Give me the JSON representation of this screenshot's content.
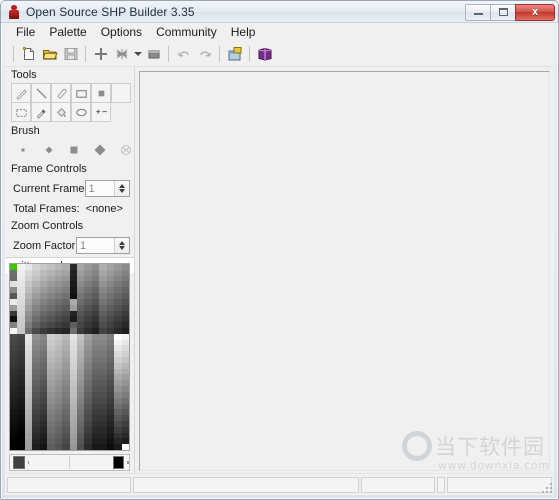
{
  "window": {
    "title": "Open Source SHP Builder 3.35",
    "app_icon": "shp-builder-icon",
    "minimize_label": "",
    "maximize_label": "",
    "close_label": "x"
  },
  "menubar": {
    "items": [
      {
        "label": "File"
      },
      {
        "label": "Palette"
      },
      {
        "label": "Options"
      },
      {
        "label": "Community"
      },
      {
        "label": "Help"
      }
    ]
  },
  "toolbar": {
    "buttons": [
      {
        "name": "new-file-icon",
        "enabled": true
      },
      {
        "name": "open-file-icon",
        "enabled": true
      },
      {
        "name": "save-file-icon",
        "enabled": false
      },
      {
        "name": "add-frame-icon",
        "enabled": true
      },
      {
        "name": "mesh-icon",
        "enabled": true
      },
      {
        "name": "fill-rect-icon",
        "enabled": true
      },
      {
        "name": "undo-icon",
        "enabled": false
      },
      {
        "name": "redo-icon",
        "enabled": false
      },
      {
        "name": "properties-icon",
        "enabled": true
      },
      {
        "name": "manual-book-icon",
        "enabled": true
      }
    ]
  },
  "tools_panel": {
    "title": "Tools",
    "tools": [
      {
        "name": "pencil-tool",
        "selected": false
      },
      {
        "name": "line-tool",
        "selected": false
      },
      {
        "name": "eraser-tool",
        "selected": false
      },
      {
        "name": "rectangle-tool",
        "selected": false
      },
      {
        "name": "filled-rect-tool",
        "selected": false
      },
      {
        "name": "empty-tool",
        "selected": false
      },
      {
        "name": "select-tool",
        "selected": false
      },
      {
        "name": "eyedropper-tool",
        "selected": false
      },
      {
        "name": "fill-bucket-tool",
        "selected": false
      },
      {
        "name": "ellipse-tool",
        "selected": false
      },
      {
        "name": "shift-colors-tool",
        "selected": false
      }
    ]
  },
  "brush_panel": {
    "title": "Brush",
    "sizes": [
      {
        "name": "brush-size-1"
      },
      {
        "name": "brush-size-2"
      },
      {
        "name": "brush-size-3"
      },
      {
        "name": "brush-size-4"
      },
      {
        "name": "brush-size-5"
      }
    ]
  },
  "frame_controls": {
    "title": "Frame Controls",
    "current_frame_label": "Current Frame",
    "current_frame_value": "1",
    "total_frames_label": "Total Frames:",
    "total_frames_value": "<none>"
  },
  "zoom_controls": {
    "title": "Zoom Controls",
    "zoom_factor_label": "Zoom Factor",
    "zoom_factor_value": "1"
  },
  "palette": {
    "name": "unittem.pal",
    "foreground_color": "#3f3f3f",
    "background_color": "#000000",
    "transparent_color": "#3cc800",
    "colors": [
      "#3cc800",
      "#f2f2f2",
      "#e8e8e8",
      "#d4d4d4",
      "#c8c8c8",
      "#c0c0c0",
      "#b6b6b6",
      "#aeaeae",
      "#2a2a2a",
      "#a8a8a8",
      "#9a9a9a",
      "#8e8e8e",
      "#b0b0b0",
      "#a4a4a4",
      "#989898",
      "#8c8c8c",
      "#6e6e6e",
      "#eeeeee",
      "#d8d8d8",
      "#cacaca",
      "#bcbcbc",
      "#b4b4b4",
      "#aaaaaa",
      "#a2a2a2",
      "#242424",
      "#9e9e9e",
      "#909090",
      "#848484",
      "#a6a6a6",
      "#9a9a9a",
      "#8e8e8e",
      "#828282",
      "#6a6a6a",
      "#eaeaea",
      "#d0d0d0",
      "#c0c0c0",
      "#b2b2b2",
      "#a8a8a8",
      "#9e9e9e",
      "#969696",
      "#1e1e1e",
      "#949494",
      "#868686",
      "#7a7a7a",
      "#9c9c9c",
      "#909090",
      "#848484",
      "#787878",
      "#e0e0e0",
      "#e6e6e6",
      "#c6c6c6",
      "#b4b4b4",
      "#a6a6a6",
      "#9c9c9c",
      "#929292",
      "#8a8a8a",
      "#1a1a1a",
      "#8a8a8a",
      "#7c7c7c",
      "#707070",
      "#929292",
      "#868686",
      "#7a7a7a",
      "#6e6e6e",
      "#8a8a8a",
      "#e2e2e2",
      "#bcbcbc",
      "#a8a8a8",
      "#9a9a9a",
      "#909090",
      "#868686",
      "#7e7e7e",
      "#161616",
      "#808080",
      "#727272",
      "#666666",
      "#888888",
      "#7c7c7c",
      "#707070",
      "#646464",
      "#565656",
      "#dedede",
      "#b2b2b2",
      "#9c9c9c",
      "#8e8e8e",
      "#848484",
      "#7a7a7a",
      "#727272",
      "#121212",
      "#767676",
      "#686868",
      "#5c5c5c",
      "#7e7e7e",
      "#727272",
      "#666666",
      "#5a5a5a",
      "#eaeaea",
      "#dadada",
      "#a8a8a8",
      "#909090",
      "#828282",
      "#787878",
      "#6e6e6e",
      "#666666",
      "#aaaaaa",
      "#6c6c6c",
      "#5e5e5e",
      "#525252",
      "#747474",
      "#686868",
      "#5c5c5c",
      "#505050",
      "#9c9c9c",
      "#d6d6d6",
      "#9e9e9e",
      "#848484",
      "#767676",
      "#6c6c6c",
      "#626262",
      "#5a5a5a",
      "#9e9e9e",
      "#626262",
      "#545454",
      "#484848",
      "#6a6a6a",
      "#5e5e5e",
      "#525252",
      "#464646",
      "#3a3a3a",
      "#d2d2d2",
      "#949494",
      "#787878",
      "#6a6a6a",
      "#606060",
      "#565656",
      "#4e4e4e",
      "#242424",
      "#585858",
      "#4a4a4a",
      "#3e3e3e",
      "#606060",
      "#545454",
      "#484848",
      "#3c3c3c",
      "#101010",
      "#cecece",
      "#8a8a8a",
      "#6c6c6c",
      "#5e5e5e",
      "#545454",
      "#4a4a4a",
      "#424242",
      "#1c1c1c",
      "#4e4e4e",
      "#404040",
      "#343434",
      "#565656",
      "#4a4a4a",
      "#3e3e3e",
      "#323232",
      "#828282",
      "#cacaca",
      "#7e7e7e",
      "#606060",
      "#525252",
      "#484848",
      "#3e3e3e",
      "#363636",
      "#5e5e5e",
      "#444444",
      "#363636",
      "#2a2a2a",
      "#4c4c4c",
      "#404040",
      "#343434",
      "#282828",
      "#f6f6f6",
      "#c6c6c6",
      "#6a6a6a",
      "#4a4a4a",
      "#3c3c3c",
      "#323232",
      "#2a2a2a",
      "#242424",
      "#707070",
      "#3a3a3a",
      "#2c2c2c",
      "#202020",
      "#424242",
      "#363636",
      "#2a2a2a",
      "#1e1e1e",
      "#4a4a4a",
      "#444444",
      "#e6e6e6",
      "#909090",
      "#868686",
      "#d0d0d0",
      "#c6c6c6",
      "#b8b8b8",
      "#e4e4e4",
      "#c2c2c2",
      "#9e9e9e",
      "#8a8a8a",
      "#8a8a8a",
      "#7e7e7e",
      "#ffffff",
      "#f4f4f4",
      "#464646",
      "#404040",
      "#e2e2e2",
      "#8a8a8a",
      "#808080",
      "#cacaca",
      "#c0c0c0",
      "#b2b2b2",
      "#e0e0e0",
      "#bcbcbc",
      "#989898",
      "#848484",
      "#848484",
      "#787878",
      "#f2f2f2",
      "#e8e8e8",
      "#424242",
      "#3c3c3c",
      "#dedede",
      "#848484",
      "#7a7a7a",
      "#c4c4c4",
      "#bababa",
      "#acacac",
      "#dcdcdc",
      "#b6b6b6",
      "#929292",
      "#7e7e7e",
      "#7e7e7e",
      "#727272",
      "#e6e6e6",
      "#dcdcdc",
      "#3e3e3e",
      "#383838",
      "#dadada",
      "#7e7e7e",
      "#747474",
      "#bebebe",
      "#b4b4b4",
      "#a6a6a6",
      "#d8d8d8",
      "#b0b0b0",
      "#8c8c8c",
      "#787878",
      "#787878",
      "#6c6c6c",
      "#dadada",
      "#d0d0d0",
      "#3a3a3a",
      "#343434",
      "#d6d6d6",
      "#787878",
      "#6e6e6e",
      "#b8b8b8",
      "#aeaeae",
      "#a0a0a0",
      "#d4d4d4",
      "#aaaaaa",
      "#868686",
      "#727272",
      "#727272",
      "#666666",
      "#cecece",
      "#c4c4c4",
      "#363636",
      "#303030",
      "#d2d2d2",
      "#727272",
      "#686868",
      "#b2b2b2",
      "#a8a8a8",
      "#9a9a9a",
      "#d0d0d0",
      "#a4a4a4",
      "#808080",
      "#6c6c6c",
      "#6c6c6c",
      "#606060",
      "#c2c2c2",
      "#b8b8b8",
      "#323232",
      "#2c2c2c",
      "#cecece",
      "#6c6c6c",
      "#626262",
      "#acacac",
      "#a2a2a2",
      "#949494",
      "#cccccc",
      "#9e9e9e",
      "#7a7a7a",
      "#666666",
      "#666666",
      "#5a5a5a",
      "#b6b6b6",
      "#acacac",
      "#2e2e2e",
      "#282828",
      "#cacaca",
      "#666666",
      "#5c5c5c",
      "#a6a6a6",
      "#9c9c9c",
      "#8e8e8e",
      "#c8c8c8",
      "#989898",
      "#747474",
      "#606060",
      "#606060",
      "#545454",
      "#aaaaaa",
      "#a0a0a0",
      "#2a2a2a",
      "#242424",
      "#c6c6c6",
      "#606060",
      "#565656",
      "#a0a0a0",
      "#969696",
      "#888888",
      "#c4c4c4",
      "#929292",
      "#6e6e6e",
      "#5a5a5a",
      "#5a5a5a",
      "#4e4e4e",
      "#9e9e9e",
      "#949494",
      "#262626",
      "#202020",
      "#c2c2c2",
      "#5a5a5a",
      "#505050",
      "#9a9a9a",
      "#909090",
      "#828282",
      "#c0c0c0",
      "#8c8c8c",
      "#686868",
      "#545454",
      "#545454",
      "#484848",
      "#929292",
      "#888888",
      "#222222",
      "#1c1c1c",
      "#bebebe",
      "#545454",
      "#4a4a4a",
      "#949494",
      "#8a8a8a",
      "#7c7c7c",
      "#bcbcbc",
      "#868686",
      "#626262",
      "#4e4e4e",
      "#4e4e4e",
      "#424242",
      "#868686",
      "#7c7c7c",
      "#1e1e1e",
      "#181818",
      "#bababa",
      "#4e4e4e",
      "#444444",
      "#8e8e8e",
      "#848484",
      "#767676",
      "#b8b8b8",
      "#808080",
      "#5c5c5c",
      "#484848",
      "#484848",
      "#3c3c3c",
      "#7a7a7a",
      "#707070",
      "#1a1a1a",
      "#141414",
      "#b6b6b6",
      "#484848",
      "#3e3e3e",
      "#888888",
      "#7e7e7e",
      "#707070",
      "#b4b4b4",
      "#7a7a7a",
      "#565656",
      "#424242",
      "#424242",
      "#363636",
      "#6e6e6e",
      "#646464",
      "#161616",
      "#101010",
      "#b2b2b2",
      "#424242",
      "#383838",
      "#828282",
      "#787878",
      "#6a6a6a",
      "#b0b0b0",
      "#747474",
      "#505050",
      "#3c3c3c",
      "#3c3c3c",
      "#303030",
      "#626262",
      "#585858",
      "#121212",
      "#0c0c0c",
      "#aeaeae",
      "#3c3c3c",
      "#323232",
      "#7c7c7c",
      "#727272",
      "#646464",
      "#acacac",
      "#6e6e6e",
      "#4a4a4a",
      "#363636",
      "#363636",
      "#2a2a2a",
      "#565656",
      "#4c4c4c",
      "#0e0e0e",
      "#080808",
      "#aaaaaa",
      "#363636",
      "#2c2c2c",
      "#767676",
      "#6c6c6c",
      "#5e5e5e",
      "#a8a8a8",
      "#686868",
      "#444444",
      "#303030",
      "#303030",
      "#242424",
      "#4a4a4a",
      "#404040",
      "#0a0a0a",
      "#040404",
      "#a6a6a6",
      "#303030",
      "#262626",
      "#707070",
      "#666666",
      "#585858",
      "#a4a4a4",
      "#626262",
      "#3e3e3e",
      "#2a2a2a",
      "#2a2a2a",
      "#1e1e1e",
      "#3e3e3e",
      "#343434",
      "#060606",
      "#000000",
      "#a2a2a2",
      "#2a2a2a",
      "#202020",
      "#6a6a6a",
      "#606060",
      "#525252",
      "#a0a0a0",
      "#5c5c5c",
      "#383838",
      "#242424",
      "#242424",
      "#181818",
      "#323232",
      "#282828",
      "#020202",
      "#000000",
      "#9e9e9e",
      "#242424",
      "#1a1a1a",
      "#646464",
      "#5a5a5a",
      "#4c4c4c",
      "#9c9c9c",
      "#565656",
      "#323232",
      "#1e1e1e",
      "#1e1e1e",
      "#121212",
      "#262626",
      "#1c1c1c",
      "#000000",
      "#000000",
      "#9a9a9a",
      "#1e1e1e",
      "#141414",
      "#5e5e5e",
      "#545454",
      "#464646",
      "#989898",
      "#505050",
      "#2c2c2c",
      "#181818",
      "#181818",
      "#0c0c0c",
      "#1a1a1a",
      "#ffffff"
    ]
  },
  "statusbar": {
    "panels": [
      "",
      "",
      "",
      "",
      ""
    ]
  },
  "watermark": {
    "brand": "当下软件园",
    "url": "www.downxia.com"
  }
}
